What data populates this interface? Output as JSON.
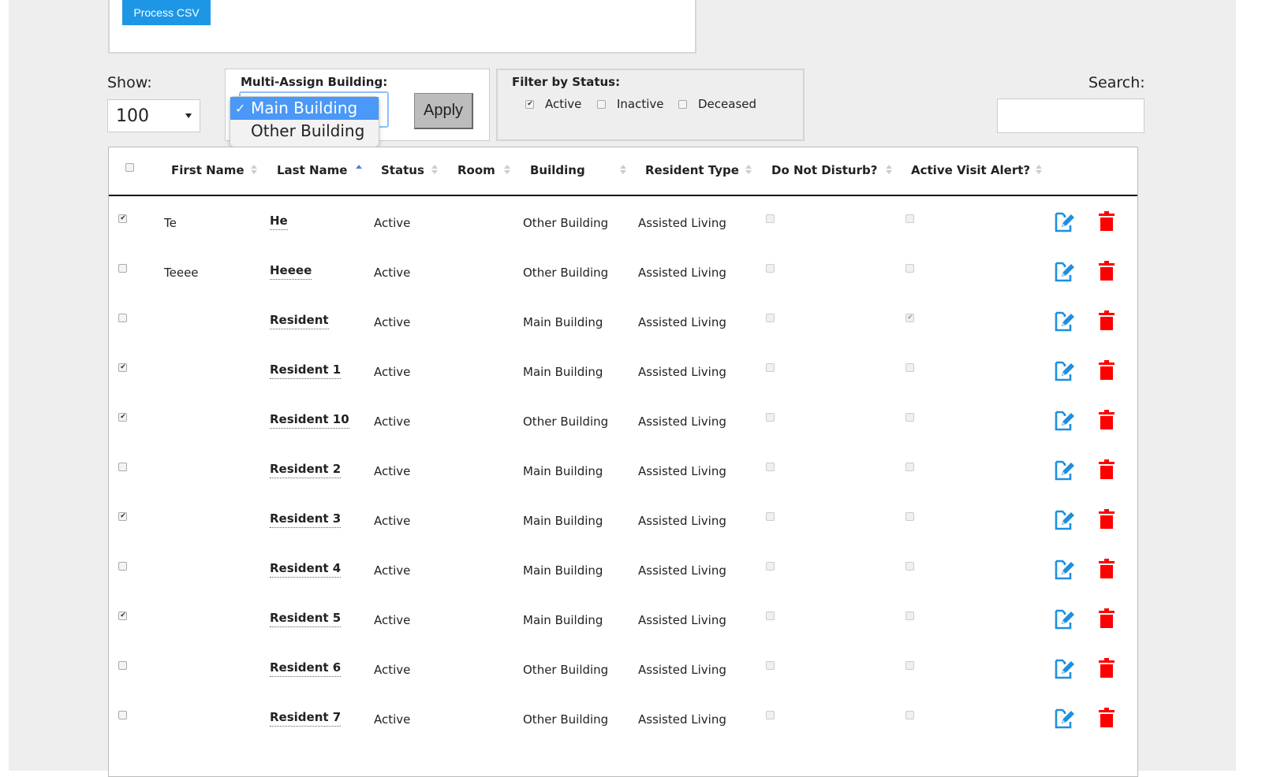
{
  "csv": {
    "process_button": "Process CSV"
  },
  "show": {
    "label": "Show:",
    "value": "100"
  },
  "multi_assign": {
    "label": "Multi-Assign Building:",
    "options": [
      "Main Building",
      "Other Building"
    ],
    "selected": "Main Building",
    "apply_label": "Apply"
  },
  "filter": {
    "label": "Filter by Status:",
    "items": [
      {
        "label": "Active",
        "checked": true
      },
      {
        "label": "Inactive",
        "checked": false
      },
      {
        "label": "Deceased",
        "checked": false
      }
    ]
  },
  "search": {
    "label": "Search:",
    "value": ""
  },
  "table": {
    "headers": [
      "First Name",
      "Last Name",
      "Status",
      "Room",
      "Building",
      "Resident Type",
      "Do Not Disturb?",
      "Active Visit Alert?"
    ],
    "sorted_column": "Last Name",
    "sort_direction": "asc",
    "rows": [
      {
        "selected": true,
        "first": "Te",
        "last": "He",
        "status": "Active",
        "room": "",
        "building": "Other Building",
        "type": "Assisted Living",
        "dnd": false,
        "alert": false
      },
      {
        "selected": false,
        "first": "Teeee",
        "last": "Heeee",
        "status": "Active",
        "room": "",
        "building": "Other Building",
        "type": "Assisted Living",
        "dnd": false,
        "alert": false
      },
      {
        "selected": false,
        "first": "",
        "last": "Resident",
        "status": "Active",
        "room": "",
        "building": "Main Building",
        "type": "Assisted Living",
        "dnd": false,
        "alert": true
      },
      {
        "selected": true,
        "first": "",
        "last": "Resident 1",
        "status": "Active",
        "room": "",
        "building": "Main Building",
        "type": "Assisted Living",
        "dnd": false,
        "alert": false
      },
      {
        "selected": true,
        "first": "",
        "last": "Resident 10",
        "status": "Active",
        "room": "",
        "building": "Other Building",
        "type": "Assisted Living",
        "dnd": false,
        "alert": false
      },
      {
        "selected": false,
        "first": "",
        "last": "Resident 2",
        "status": "Active",
        "room": "",
        "building": "Main Building",
        "type": "Assisted Living",
        "dnd": false,
        "alert": false
      },
      {
        "selected": true,
        "first": "",
        "last": "Resident 3",
        "status": "Active",
        "room": "",
        "building": "Main Building",
        "type": "Assisted Living",
        "dnd": false,
        "alert": false
      },
      {
        "selected": false,
        "first": "",
        "last": "Resident 4",
        "status": "Active",
        "room": "",
        "building": "Main Building",
        "type": "Assisted Living",
        "dnd": false,
        "alert": false
      },
      {
        "selected": true,
        "first": "",
        "last": "Resident 5",
        "status": "Active",
        "room": "",
        "building": "Main Building",
        "type": "Assisted Living",
        "dnd": false,
        "alert": false
      },
      {
        "selected": false,
        "first": "",
        "last": "Resident 6",
        "status": "Active",
        "room": "",
        "building": "Other Building",
        "type": "Assisted Living",
        "dnd": false,
        "alert": false
      },
      {
        "selected": false,
        "first": "",
        "last": "Resident 7",
        "status": "Active",
        "room": "",
        "building": "Other Building",
        "type": "Assisted Living",
        "dnd": false,
        "alert": false
      }
    ]
  },
  "colors": {
    "primary": "#1e96e6",
    "edit": "#1e8fe0",
    "delete": "#ff0000",
    "highlight": "#4a98f7"
  }
}
